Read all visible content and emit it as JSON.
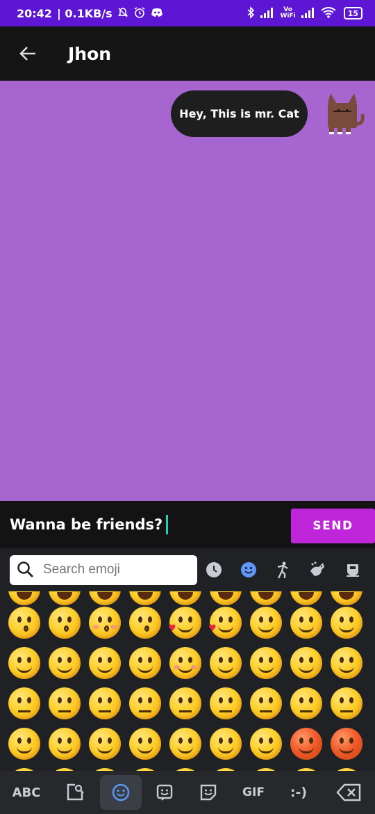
{
  "status_bar": {
    "time": "20:42",
    "network_speed": "| 0.1KB/s",
    "vowifi_top": "Vo",
    "vowifi_bottom": "WiFi",
    "battery_level": "15",
    "battery_fraction": 0.15,
    "icons": [
      "bell-off-icon",
      "alarm-icon",
      "discord-icon",
      "bluetooth-icon",
      "signal-icon",
      "wifi-icon",
      "battery-icon"
    ]
  },
  "app_bar": {
    "title": "Jhon",
    "back_icon": "arrow-left-icon"
  },
  "chat": {
    "background": "#a765cf",
    "messages": [
      {
        "text": "Hey, This is mr. Cat",
        "sender_avatar": "cat-avatar"
      }
    ]
  },
  "composer": {
    "message_text": "Wanna be friends?",
    "send_label": "SEND",
    "send_color": "#c026d9"
  },
  "keyboard": {
    "search_placeholder": "Search emoji",
    "category_tabs": [
      "recent-icon",
      "smileys-icon",
      "people-icon",
      "animals-icon",
      "food-icon"
    ],
    "active_category": "smileys-icon",
    "bottom_bar": {
      "abc_label": "ABC",
      "gif_label": "GIF",
      "emoticon_label": ":-)",
      "keys": [
        "abc-key",
        "clipboard-search-key",
        "emoji-key",
        "emoticon-face-key",
        "sticker-key",
        "gif-key",
        "emoticon-text-key",
        "backspace-key"
      ]
    }
  }
}
